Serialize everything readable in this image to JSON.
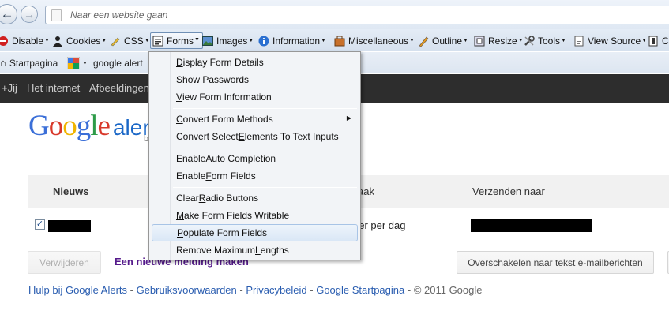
{
  "browser": {
    "address_placeholder": "Naar een website gaan",
    "toolbar": [
      {
        "label": "Disable",
        "icon": "no-entry-icon"
      },
      {
        "label": "Cookies",
        "icon": "person-icon"
      },
      {
        "label": "CSS",
        "icon": "pencil-icon"
      },
      {
        "label": "Forms",
        "icon": "form-icon"
      },
      {
        "label": "Images",
        "icon": "image-icon"
      },
      {
        "label": "Information",
        "icon": "info-icon"
      },
      {
        "label": "Miscellaneous",
        "icon": "toolbox-icon"
      },
      {
        "label": "Outline",
        "icon": "pen-icon"
      },
      {
        "label": "Resize",
        "icon": "resize-icon"
      },
      {
        "label": "Tools",
        "icon": "wrench-icon"
      },
      {
        "label": "View Source",
        "icon": "document-icon"
      }
    ],
    "bookmarks": [
      {
        "label": "Startpagina",
        "icon": "home-icon"
      },
      {
        "label": "google alert",
        "icon": "google-icon"
      }
    ]
  },
  "google_bar": [
    "+Jij",
    "Het internet",
    "Afbeeldingen"
  ],
  "page": {
    "logo_text": "Google",
    "logo_suffix": "aler",
    "logo_beta": "b",
    "table_headers": [
      "Nieuws",
      "aak",
      "Verzenden naar"
    ],
    "row_frequency": "eer per dag",
    "row_checked": true,
    "delete_button": "Verwijderen",
    "new_alert_link": "Een nieuwe melding maken",
    "switch_button": "Overschakelen naar tekst e-mailberichten",
    "footer_links": [
      "Hulp bij Google Alerts",
      "Gebruiksvoorwaarden",
      "Privacybeleid",
      "Google Startpagina"
    ],
    "footer_separator": " - ",
    "footer_copyright": "© 2011 Google"
  },
  "forms_menu": {
    "items": [
      {
        "pre": "",
        "ul": "D",
        "post": "isplay Form Details"
      },
      {
        "pre": "",
        "ul": "S",
        "post": "how Passwords"
      },
      {
        "pre": "",
        "ul": "V",
        "post": "iew Form Information"
      },
      {
        "pre": "",
        "ul": "C",
        "post": "onvert Form Methods",
        "submenu": true
      },
      {
        "pre": "Convert Select ",
        "ul": "E",
        "post": "lements To Text Inputs"
      },
      {
        "pre": "Enable ",
        "ul": "A",
        "post": "uto Completion"
      },
      {
        "pre": "Enable ",
        "ul": "F",
        "post": "orm Fields"
      },
      {
        "pre": "Clear ",
        "ul": "R",
        "post": "adio Buttons"
      },
      {
        "pre": "",
        "ul": "M",
        "post": "ake Form Fields Writable"
      },
      {
        "pre": "",
        "ul": "P",
        "post": "opulate Form Fields",
        "highlighted": true
      },
      {
        "pre": "Remove Maximum ",
        "ul": "L",
        "post": "engths"
      }
    ]
  }
}
